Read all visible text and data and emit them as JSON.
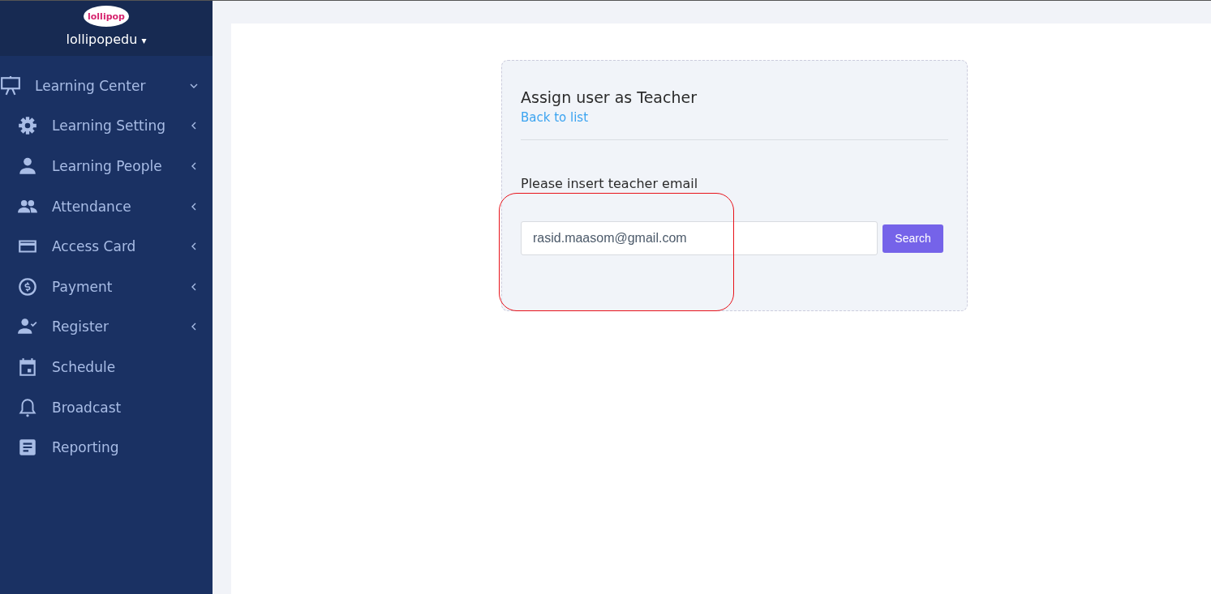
{
  "sidebar": {
    "logo_text": "lollipop",
    "account": {
      "name": "lollipopedu",
      "caret": "▾"
    },
    "menu": [
      {
        "label": "Learning Center",
        "kind": "submenu",
        "expanded": true,
        "children": [
          {
            "label": "Learning Setting",
            "kind": "submenu",
            "expanded": false
          },
          {
            "label": "Learning People",
            "kind": "submenu",
            "expanded": false
          },
          {
            "label": "Attendance",
            "kind": "submenu",
            "expanded": false
          },
          {
            "label": "Access Card",
            "kind": "submenu",
            "expanded": false
          },
          {
            "label": "Payment",
            "kind": "submenu",
            "expanded": false
          },
          {
            "label": "Register",
            "kind": "submenu",
            "expanded": false
          },
          {
            "label": "Schedule",
            "kind": "link"
          },
          {
            "label": "Broadcast",
            "kind": "link"
          },
          {
            "label": "Reporting",
            "kind": "link"
          }
        ]
      }
    ]
  },
  "card": {
    "title": "Assign user as Teacher",
    "back_link": "Back to list",
    "field_label": "Please insert teacher email",
    "email": {
      "value": "rasid.maasom@gmail.com"
    },
    "search_button": "Search"
  }
}
